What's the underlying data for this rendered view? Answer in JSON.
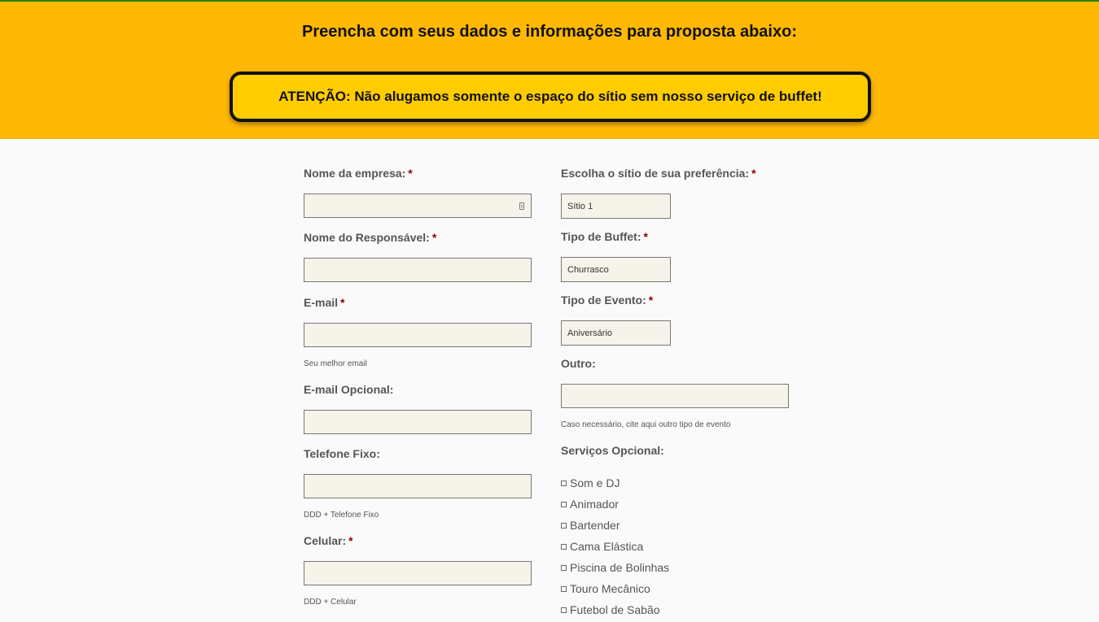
{
  "banner": {
    "title": "Preencha com seus dados e informações para proposta abaixo:",
    "notice": "ATENÇÃO: Não alugamos somente o espaço do sítio sem nosso serviço de buffet!"
  },
  "form": {
    "required_mark": "*",
    "left": {
      "company": {
        "label": "Nome da empresa:",
        "value": ""
      },
      "responsible": {
        "label": "Nome do Responsável:",
        "value": ""
      },
      "email": {
        "label": "E-mail",
        "value": "",
        "hint": "Seu melhor email"
      },
      "email_optional": {
        "label": "E-mail Opcional:",
        "value": ""
      },
      "landline": {
        "label": "Telefone Fixo:",
        "value": "",
        "hint": "DDD + Telefone Fixo"
      },
      "mobile": {
        "label": "Celular:",
        "value": "",
        "hint": "DDD + Celular"
      }
    },
    "right": {
      "venue": {
        "label": "Escolha o sítio de sua preferência:",
        "selected": "Sítio 1"
      },
      "buffet": {
        "label": "Tipo de Buffet:",
        "selected": "Churrasco"
      },
      "event": {
        "label": "Tipo de Evento:",
        "selected": "Aniversário"
      },
      "other": {
        "label": "Outro:",
        "value": "",
        "hint": "Caso necessário, cite aqui outro tipo de evento"
      },
      "services": {
        "label": "Serviços Opcional:",
        "options": [
          {
            "label": "Som e DJ",
            "checked": false
          },
          {
            "label": "Animador",
            "checked": false
          },
          {
            "label": "Bartender",
            "checked": false
          },
          {
            "label": "Cama Elástica",
            "checked": false
          },
          {
            "label": "Piscina de Bolinhas",
            "checked": false
          },
          {
            "label": "Touro Mecânico",
            "checked": false
          },
          {
            "label": "Futebol de Sabão",
            "checked": false
          }
        ]
      }
    }
  },
  "colors": {
    "banner_bg": "#ffb804",
    "notice_bg": "#ffcc00",
    "top_line": "#2f7d12",
    "required": "#8b0000",
    "input_bg": "#f6f3ea"
  }
}
